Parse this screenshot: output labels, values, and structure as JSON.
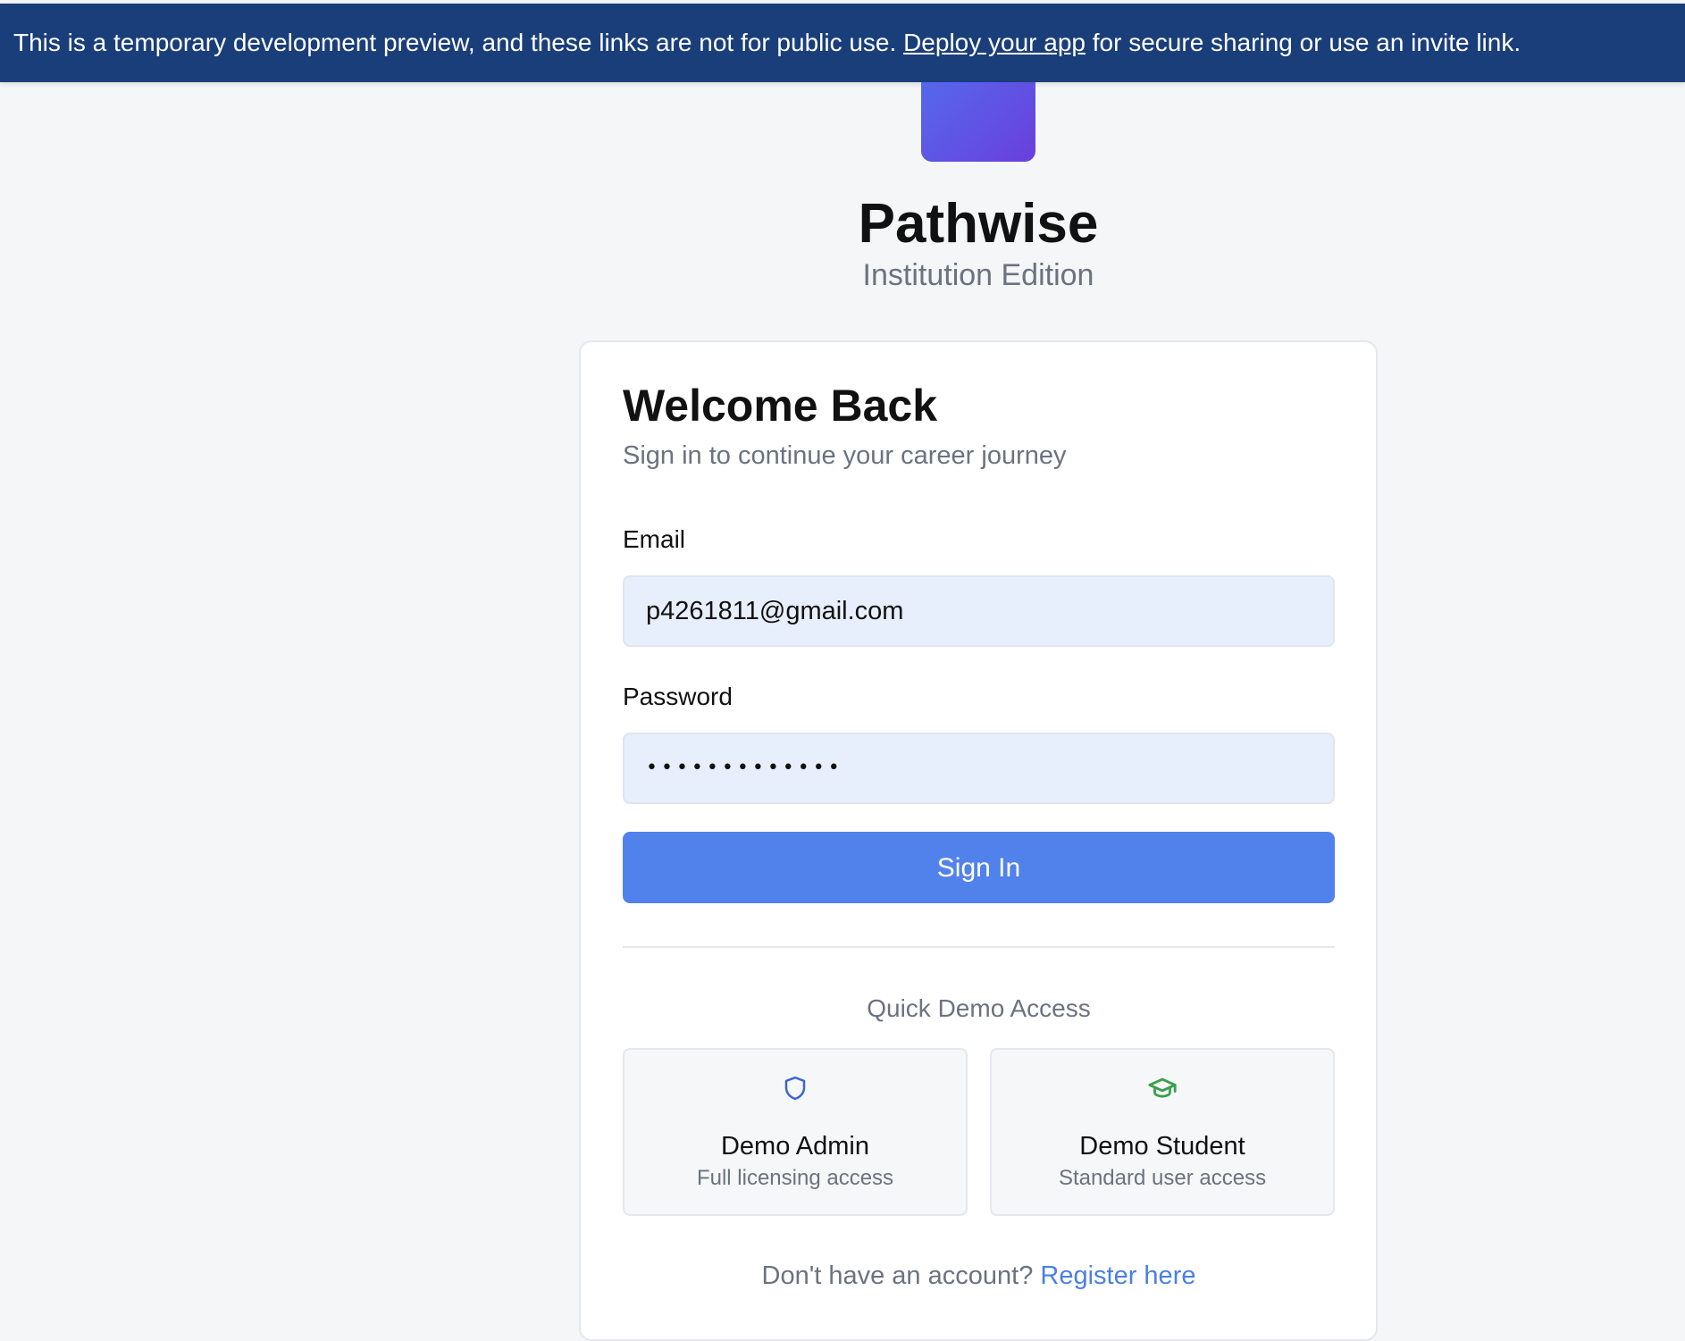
{
  "banner": {
    "text_before": "This is a temporary development preview, and these links are not for public use. ",
    "link_label": "Deploy your app",
    "text_after": " for secure sharing or use an invite link."
  },
  "brand": {
    "name": "Pathwise",
    "edition": "Institution Edition",
    "logo_gradient": [
      "#5568ec",
      "#6a3fdc"
    ]
  },
  "login": {
    "title": "Welcome Back",
    "subtitle": "Sign in to continue your career journey",
    "email_label": "Email",
    "email_value": "p4261811@gmail.com",
    "password_label": "Password",
    "password_value": "•••••••••••••",
    "submit_label": "Sign In"
  },
  "demo": {
    "heading": "Quick Demo Access",
    "options": [
      {
        "name": "Demo Admin",
        "description": "Full licensing access",
        "icon": "shield-icon",
        "icon_color": "#3b63d8"
      },
      {
        "name": "Demo Student",
        "description": "Standard user access",
        "icon": "graduation-cap-icon",
        "icon_color": "#3aa04a"
      }
    ]
  },
  "register": {
    "prompt": "Don't have an account? ",
    "link_label": "Register here"
  },
  "colors": {
    "banner_bg": "#1a3e7a",
    "primary_button": "#5182ec",
    "link": "#4a7fe6"
  }
}
